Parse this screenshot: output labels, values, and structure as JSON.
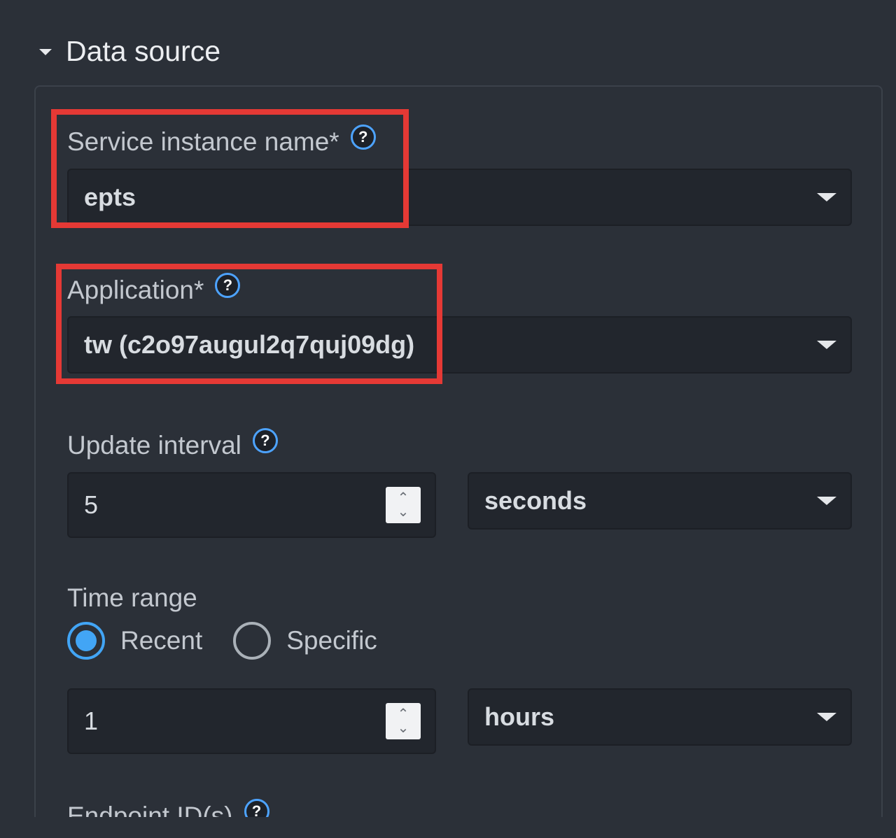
{
  "section": {
    "title": "Data source",
    "expanded": true
  },
  "service_instance": {
    "label": "Service instance name*",
    "help": "?",
    "value": "epts",
    "highlighted": true
  },
  "application": {
    "label": "Application*",
    "help": "?",
    "value": "tw (c2o97augul2q7quj09dg)",
    "highlighted": true
  },
  "update_interval": {
    "label": "Update interval",
    "help": "?",
    "value": "5",
    "unit": "seconds",
    "spinner_up": "⌃",
    "spinner_down": "⌄"
  },
  "time_range": {
    "label": "Time range",
    "options": [
      {
        "label": "Recent",
        "selected": true
      },
      {
        "label": "Specific",
        "selected": false
      }
    ],
    "value": "1",
    "unit": "hours",
    "spinner_up": "⌃",
    "spinner_down": "⌄"
  },
  "endpoint_ids": {
    "label": "Endpoint ID(s)",
    "help": "?"
  },
  "colors": {
    "background": "#2b3038",
    "input_bg": "#22262d",
    "accent": "#42a5f5",
    "highlight": "#e53935"
  }
}
